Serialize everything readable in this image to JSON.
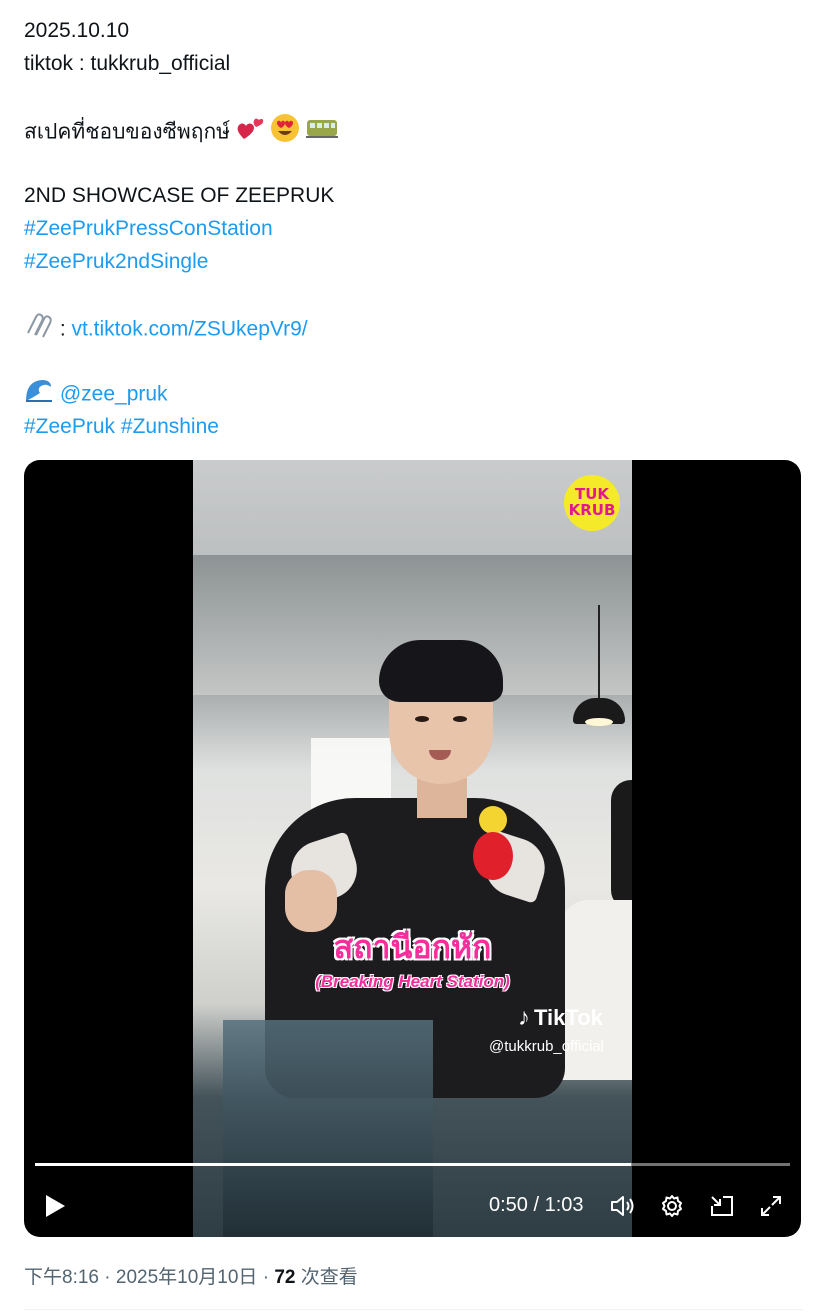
{
  "tweet": {
    "date_line": "2025.10.10",
    "source_line": "tiktok : tukkrub_official",
    "thai_line": "สเปคที่ชอบของซีพฤกษ์",
    "showcase_line": "2ND SHOWCASE OF ZEEPRUK",
    "hashtag1": "#ZeePrukPressConStation",
    "hashtag2": "#ZeePruk2ndSingle",
    "link_prefix": " : ",
    "link": "vt.tiktok.com/ZSUkepVr9/",
    "mention": "@zee_pruk",
    "hashtag3": "#ZeePruk",
    "hashtag4": "#Zunshine",
    "emojis": [
      "two-hearts-icon",
      "heart-eyes-icon",
      "tram-icon",
      "paperclip-icon",
      "wave-icon"
    ]
  },
  "video": {
    "logo_text": "TUK KRUB",
    "caption_thai": "สถานีอกหัก",
    "caption_english": "(Breaking Heart Station)",
    "watermark_brand": "TikTok",
    "watermark_handle": "@tukkrub_official",
    "progress_fraction": 0.79,
    "current_time": "0:50",
    "time_separator": " / ",
    "duration": "1:03"
  },
  "meta": {
    "time": "下午8:16",
    "sep1": " · ",
    "date": "2025年10月10日",
    "sep2": " · ",
    "views_count": "72",
    "views_label": " 次查看"
  },
  "colors": {
    "link": "#1d9bf0",
    "text": "#0f1419",
    "muted": "#536471",
    "caption_pink": "#f52e9b",
    "logo_yellow": "#f5ea2a"
  }
}
